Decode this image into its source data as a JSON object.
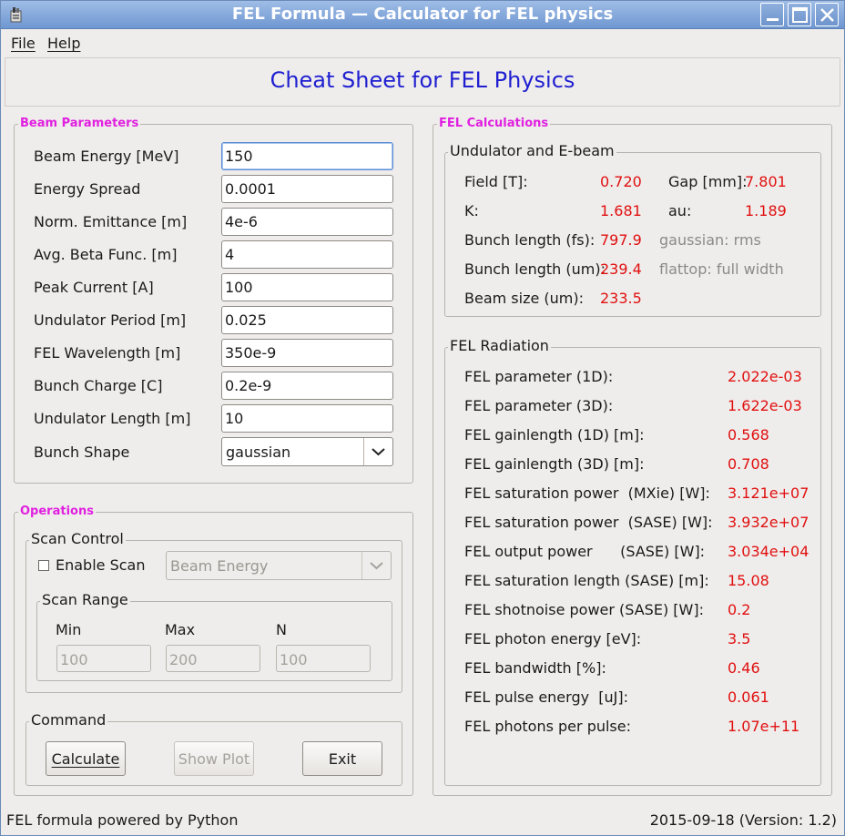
{
  "window": {
    "title": "FEL Formula — Calculator for FEL physics",
    "icon": "app-icon"
  },
  "menu": {
    "file": "File",
    "help": "Help"
  },
  "header": {
    "title": "Cheat Sheet for FEL Physics"
  },
  "beam": {
    "group_title": "Beam Parameters",
    "params": [
      {
        "label": "Beam Energy [MeV]",
        "value": "150"
      },
      {
        "label": "Energy Spread",
        "value": "0.0001"
      },
      {
        "label": "Norm. Emittance [m]",
        "value": "4e-6"
      },
      {
        "label": "Avg. Beta Func. [m]",
        "value": "4"
      },
      {
        "label": "Peak Current [A]",
        "value": "100"
      },
      {
        "label": "Undulator Period [m]",
        "value": "0.025"
      },
      {
        "label": "FEL Wavelength [m]",
        "value": "350e-9"
      },
      {
        "label": "Bunch Charge [C]",
        "value": "0.2e-9"
      },
      {
        "label": "Undulator Length [m]",
        "value": "10"
      }
    ],
    "shape_label": "Bunch Shape",
    "shape_value": "gaussian"
  },
  "ops": {
    "group_title": "Operations",
    "scan_control_title": "Scan Control",
    "enable_scan": "Enable Scan",
    "enable_scan_checked": false,
    "scan_param": "Beam Energy",
    "scan_range_title": "Scan Range",
    "min_label": "Min",
    "max_label": "Max",
    "n_label": "N",
    "min_value": "100",
    "max_value": "200",
    "n_value": "100",
    "command_title": "Command",
    "calculate": "Calculate",
    "show_plot": "Show Plot",
    "exit": "Exit"
  },
  "calc": {
    "group_title": "FEL Calculations",
    "undulator_title": "Undulator and E-beam",
    "field_label": "Field [T]:",
    "field_value": "0.720",
    "gap_label": "Gap [mm]:",
    "gap_value": "7.801",
    "k_label": "K:",
    "k_value": "1.681",
    "au_label": "au:",
    "au_value": "1.189",
    "bl_fs_label": "Bunch length (fs):",
    "bl_fs_value": "797.9",
    "bl_fs_note": "gaussian: rms",
    "bl_um_label": "Bunch length (um):",
    "bl_um_value": "239.4",
    "bl_um_note": "flattop: full width",
    "beam_size_label": "Beam size (um):",
    "beam_size_value": "233.5",
    "radiation_title": "FEL Radiation",
    "radiation": [
      {
        "label": "FEL parameter (1D):",
        "value": "2.022e-03"
      },
      {
        "label": "FEL parameter (3D):",
        "value": "1.622e-03"
      },
      {
        "label": "FEL gainlength (1D) [m]:",
        "value": "0.568"
      },
      {
        "label": "FEL gainlength (3D) [m]:",
        "value": "0.708"
      },
      {
        "label": "FEL saturation power  (MXie) [W]:",
        "value": "3.121e+07"
      },
      {
        "label": "FEL saturation power  (SASE) [W]:",
        "value": "3.932e+07"
      },
      {
        "label": "FEL output power      (SASE) [W]:",
        "value": "3.034e+04"
      },
      {
        "label": "FEL saturation length (SASE) [m]:",
        "value": "15.08"
      },
      {
        "label": "FEL shotnoise power (SASE) [W]:",
        "value": "0.2"
      },
      {
        "label": "FEL photon energy [eV]:",
        "value": "3.5"
      },
      {
        "label": "FEL bandwidth [%]:",
        "value": "0.46"
      },
      {
        "label": "FEL pulse energy  [uJ]:",
        "value": "0.061"
      },
      {
        "label": "FEL photons per pulse:",
        "value": "1.07e+11"
      }
    ]
  },
  "status": {
    "left": "FEL formula powered by Python",
    "right": "2015-09-18  (Version: 1.2)"
  },
  "colors": {
    "title_text": "#1f1fd1",
    "group_title": "#e020e0",
    "value_red": "#e01010",
    "note_gray": "#8c8a87"
  }
}
